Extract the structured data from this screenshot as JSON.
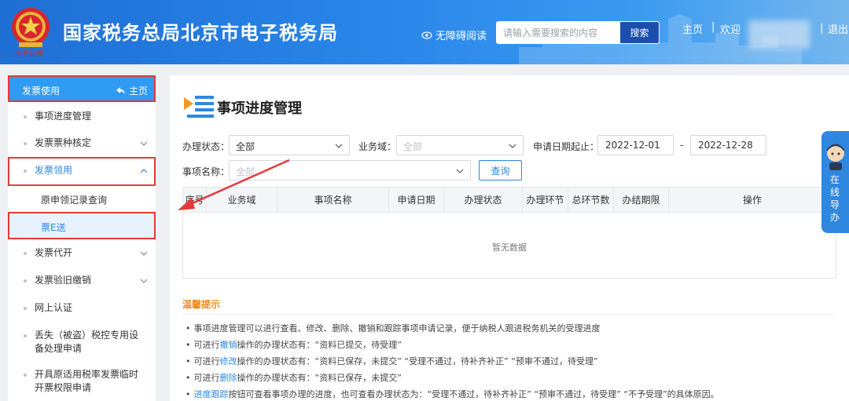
{
  "header": {
    "emblem_text": "中务认板",
    "site_title": "国家税务总局北京市电子税务局",
    "accessibility_label": "无障碍阅读",
    "search_placeholder": "请输入需要搜索的内容",
    "search_button": "搜索",
    "nav_home": "主页",
    "nav_separator": "|",
    "nav_welcome": "欢迎",
    "nav_logout": "退出"
  },
  "sidebar": {
    "head_label": "发票使用",
    "head_home": "主页",
    "items": [
      {
        "label": "事项进度管理"
      },
      {
        "label": "发票票种核定"
      },
      {
        "label": "发票领用"
      },
      {
        "label": "原申领记录查询"
      },
      {
        "label": "票E送"
      },
      {
        "label": "发票代开"
      },
      {
        "label": "发票验旧缴销"
      },
      {
        "label": "网上认证"
      },
      {
        "label": "丢失（被盗）税控专用设",
        "label2": "备处理申请"
      },
      {
        "label": "开具原适用税率发票临时",
        "label2": "开票权限申请"
      }
    ]
  },
  "main": {
    "title": "事项进度管理",
    "filters": {
      "status_label": "办理状态：",
      "status_value": "全部",
      "domain_label": "业务域：",
      "domain_placeholder": "全部",
      "date_label": "申请日期起止：",
      "date_start": "2022-12-01",
      "date_sep": "-",
      "date_end": "2022-12-28",
      "name_label": "事项名称：",
      "name_placeholder": "全部",
      "query_button": "查询"
    },
    "table": {
      "columns": [
        "序号",
        "业务域",
        "事项名称",
        "申请日期",
        "办理状态",
        "办理环节",
        "总环节数",
        "办结期限",
        "操作"
      ],
      "empty_text": "暂无数据"
    },
    "tips": {
      "title": "温馨提示",
      "line1": "事项进度管理可以进行查看、修改、删除、撤销和跟踪事项申请记录，便于纳税人跟进税务机关的受理进度",
      "line2_pre": "可进行",
      "line2_link": "撤销",
      "line2_post": "操作的办理状态有：“资料已提交，待受理”",
      "line3_pre": "可进行",
      "line3_link": "修改",
      "line3_post": "操作的办理状态有：“资料已保存，未提交”  “受理不通过，待补齐补正”  “预审不通过，待受理”",
      "line4_pre": "可进行",
      "line4_link": "删除",
      "line4_post": "操作的办理状态有：“资料已保存，未提交”",
      "line5_link": "进度跟踪",
      "line5_post": "按钮可查看事项办理的进度，也可查看办理状态为：“受理不通过，待补齐补正”  “预审不通过，待受理”  “不予受理”的具体原因。"
    }
  },
  "float_help": {
    "label": "在线导办"
  },
  "colors": {
    "header_blue": "#1f6fd4",
    "accent_blue": "#2f87e0",
    "highlight_red": "#e23a3a",
    "tips_orange": "#f08a1c"
  }
}
